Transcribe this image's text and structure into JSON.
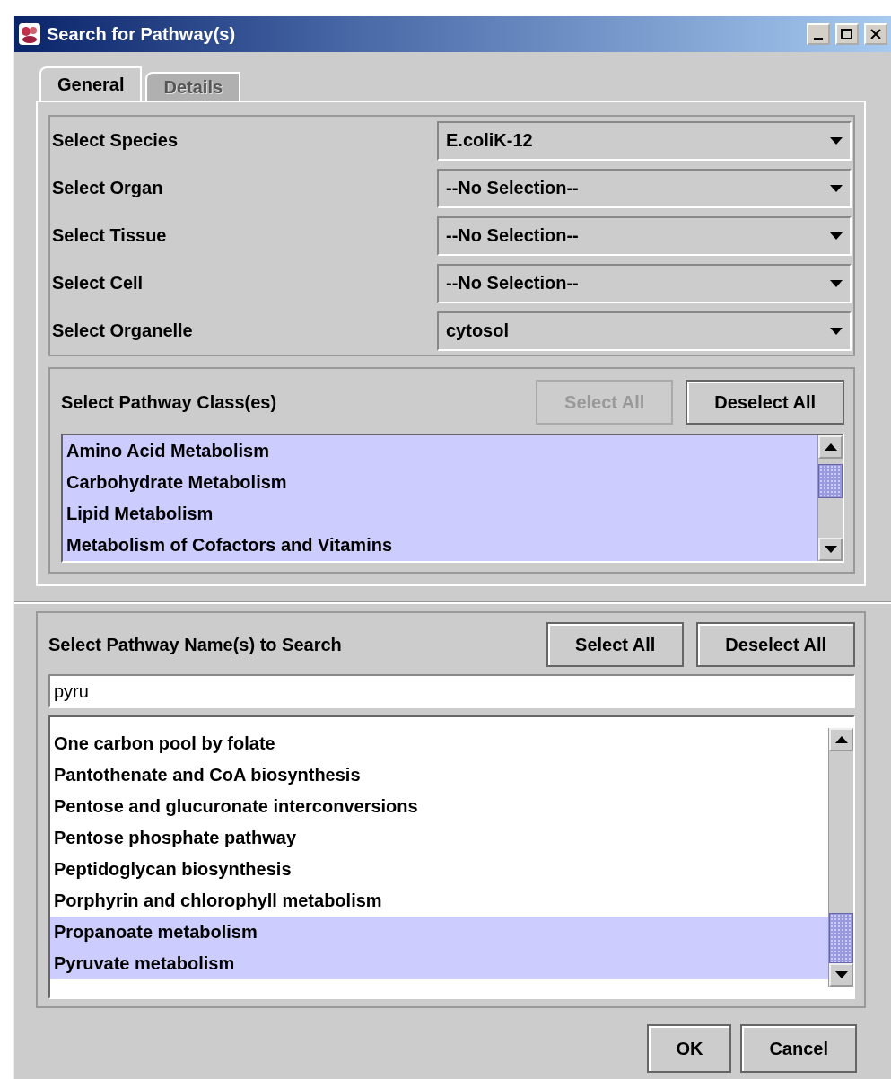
{
  "window": {
    "title": "Search for Pathway(s)"
  },
  "tabs": [
    {
      "label": "General",
      "selected": true,
      "disabled": false
    },
    {
      "label": "Details",
      "selected": false,
      "disabled": true
    }
  ],
  "filters": [
    {
      "label": "Select Species",
      "value": "E.coliK-12"
    },
    {
      "label": "Select Organ",
      "value": "--No Selection--"
    },
    {
      "label": "Select Tissue",
      "value": "--No Selection--"
    },
    {
      "label": "Select Cell",
      "value": "--No Selection--"
    },
    {
      "label": "Select Organelle",
      "value": "cytosol"
    }
  ],
  "pathway_classes": {
    "title": "Select Pathway Class(es)",
    "buttons": [
      {
        "label": "Select All",
        "disabled": true
      },
      {
        "label": "Deselect All",
        "disabled": false
      }
    ],
    "items": [
      {
        "label": "Amino Acid Metabolism",
        "selected": true
      },
      {
        "label": "Carbohydrate Metabolism",
        "selected": true
      },
      {
        "label": "Lipid Metabolism",
        "selected": true
      },
      {
        "label": "Metabolism of Cofactors and Vitamins",
        "selected": true
      }
    ]
  },
  "pathway_names": {
    "title": "Select Pathway Name(s) to Search",
    "buttons": [
      {
        "label": "Select All",
        "disabled": false
      },
      {
        "label": "Deselect All",
        "disabled": false
      }
    ],
    "search": {
      "value": "pyru"
    },
    "items": [
      {
        "label": "One carbon pool by folate",
        "selected": false
      },
      {
        "label": "Pantothenate and CoA biosynthesis",
        "selected": false
      },
      {
        "label": "Pentose and glucuronate interconversions",
        "selected": false
      },
      {
        "label": "Pentose phosphate pathway",
        "selected": false
      },
      {
        "label": "Peptidoglycan biosynthesis",
        "selected": false
      },
      {
        "label": "Porphyrin and chlorophyll metabolism",
        "selected": false
      },
      {
        "label": "Propanoate metabolism",
        "selected": true
      },
      {
        "label": "Pyruvate metabolism",
        "selected": true
      }
    ]
  },
  "footer_buttons": [
    {
      "label": "OK"
    },
    {
      "label": "Cancel"
    }
  ]
}
